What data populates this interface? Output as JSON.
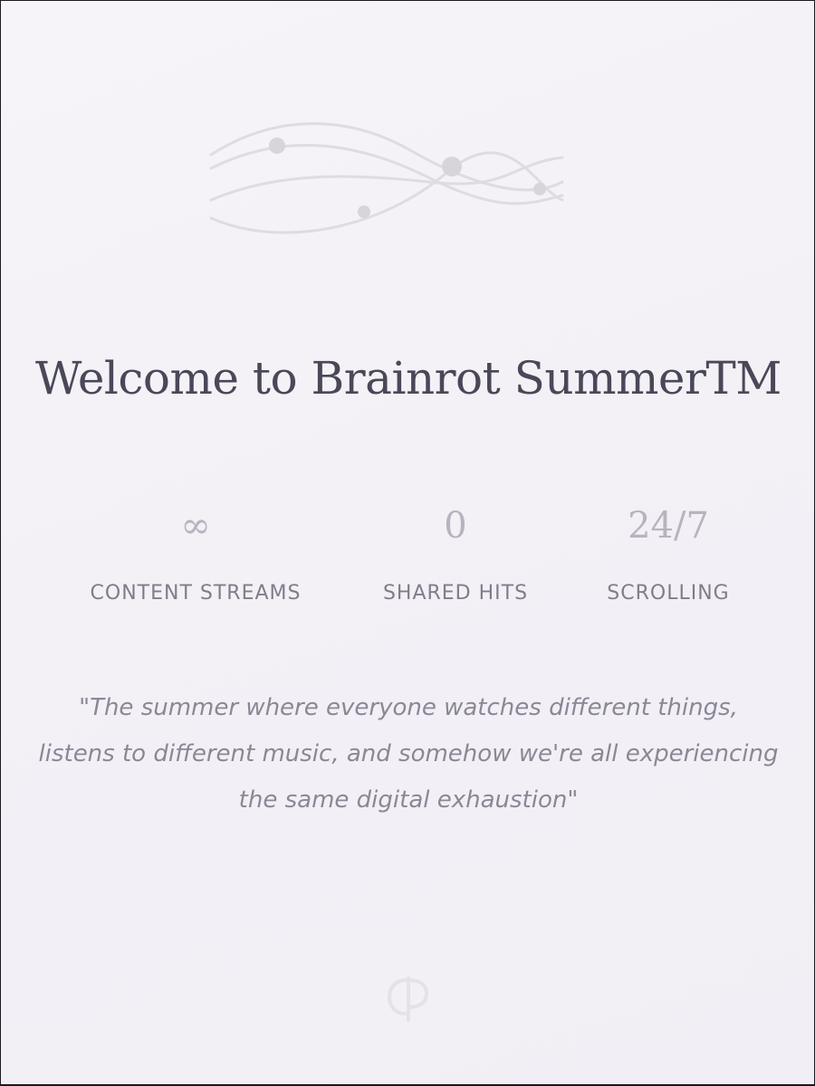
{
  "page": {
    "title": "Welcome to Brainrot SummerTM"
  },
  "stats": [
    {
      "value": "∞",
      "label": "CONTENT STREAMS"
    },
    {
      "value": "0",
      "label": "SHARED HITS"
    },
    {
      "value": "24/7",
      "label": "SCROLLING"
    }
  ],
  "quote": "\"The summer where everyone watches different things, listens to different music, and somehow we're all experiencing the same digital exhaustion\"",
  "colors": {
    "background": "#f4f2f7",
    "title": "#4a4858",
    "stat_value": "#b6b4bf",
    "stat_label": "#7f7d8a",
    "quote": "#8a8896",
    "decoration": "#dcdadf"
  },
  "icons": {
    "header": "wave-lines-icon",
    "footer": "monogram-logo-icon"
  }
}
